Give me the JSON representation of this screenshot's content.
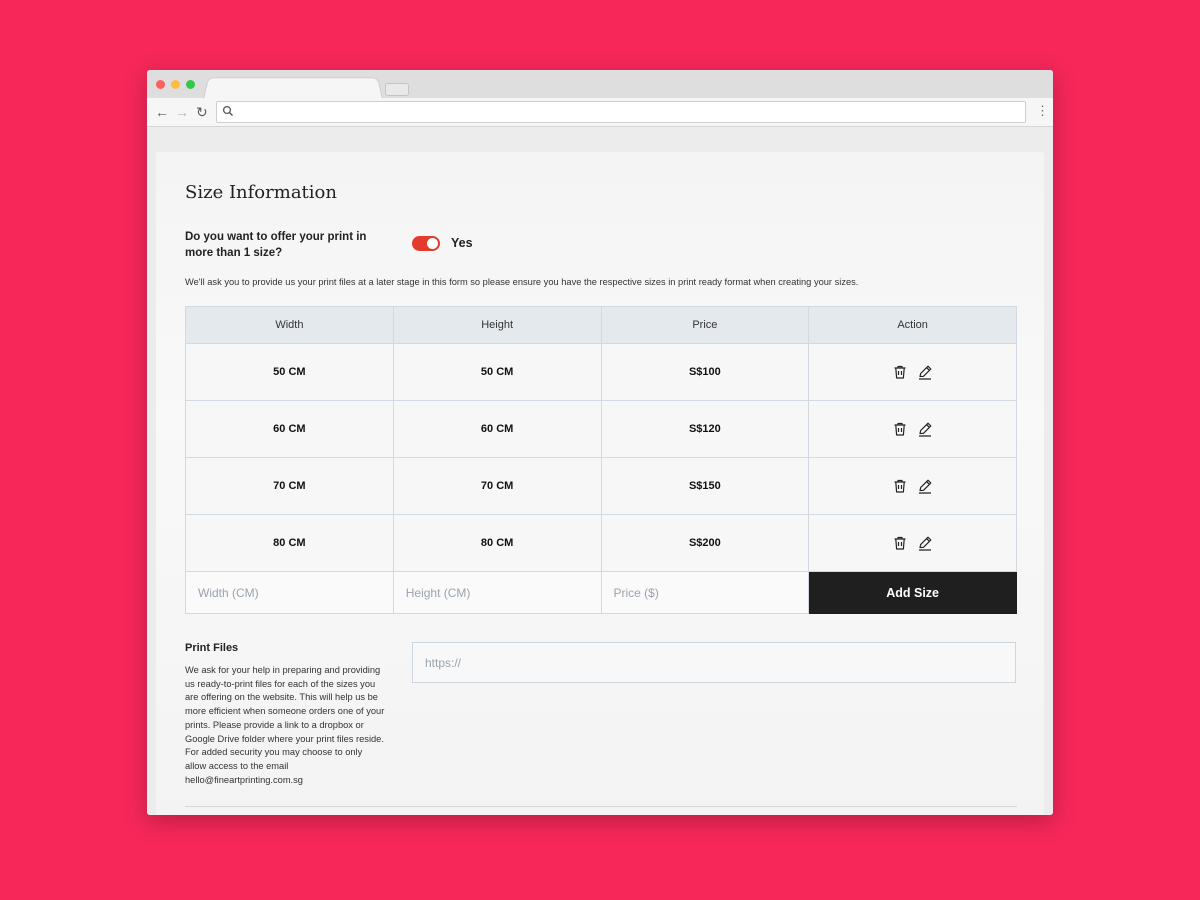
{
  "browser": {
    "nav": {
      "back": "←",
      "forward": "→",
      "reload": "↻",
      "menu": "⋮"
    }
  },
  "form": {
    "title": "Size Information",
    "question": "Do you want to offer your print in more than 1 size?",
    "toggle": {
      "on": true,
      "label": "Yes"
    },
    "note": "We'll ask you to provide us your print files at a later stage in this form so please ensure you have the respective sizes in print ready format when creating your sizes.",
    "table": {
      "headers": [
        "Width",
        "Height",
        "Price",
        "Action"
      ],
      "rows": [
        {
          "width": "50 CM",
          "height": "50 CM",
          "price": "S$100"
        },
        {
          "width": "60 CM",
          "height": "60 CM",
          "price": "S$120"
        },
        {
          "width": "70 CM",
          "height": "70 CM",
          "price": "S$150"
        },
        {
          "width": "80 CM",
          "height": "80 CM",
          "price": "S$200"
        }
      ],
      "inputs": {
        "width_placeholder": "Width (CM)",
        "height_placeholder": "Height (CM)",
        "price_placeholder": "Price ($)"
      },
      "add_label": "Add Size"
    },
    "print_files": {
      "title": "Print Files",
      "description": "We ask for your help in preparing and providing us ready-to-print files for each of the sizes you are offering on the website. This will help us be more efficient when someone orders one of your prints. Please provide a link to a dropbox or Google Drive folder where your print files reside. For added security you may choose to only allow access to the email hello@fineartprinting.com.sg",
      "url_placeholder": "https://"
    }
  },
  "colors": {
    "background": "#f7275a",
    "toggle": "#e43a2b",
    "button": "#1f1f1f"
  },
  "icons": {
    "row_actions": [
      "trash-icon",
      "pencil-icon"
    ]
  }
}
